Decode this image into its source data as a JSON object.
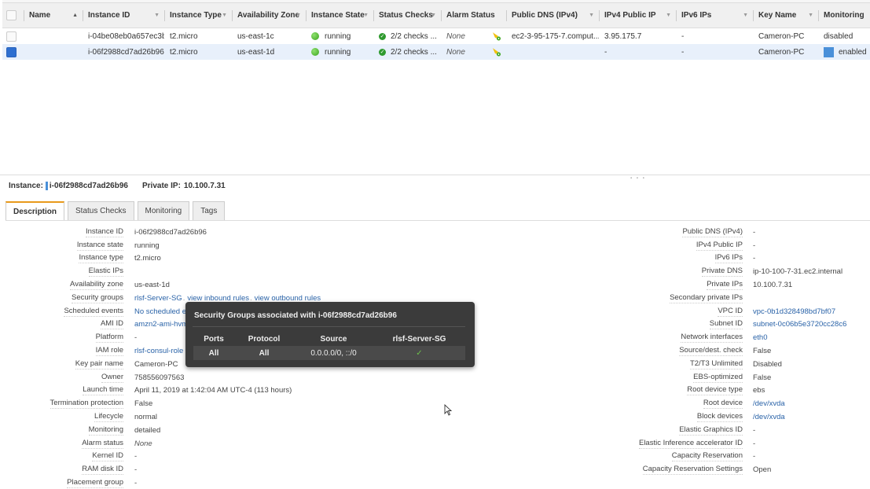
{
  "table": {
    "columns": [
      {
        "label": "Name",
        "sort": "asc"
      },
      {
        "label": "Instance ID"
      },
      {
        "label": "Instance Type"
      },
      {
        "label": "Availability Zone"
      },
      {
        "label": "Instance State"
      },
      {
        "label": "Status Checks"
      },
      {
        "label": "Alarm Status"
      },
      {
        "label": "Public DNS (IPv4)"
      },
      {
        "label": "IPv4 Public IP"
      },
      {
        "label": "IPv6 IPs"
      },
      {
        "label": "Key Name"
      },
      {
        "label": "Monitoring"
      }
    ],
    "rows": [
      {
        "selected": false,
        "name": "",
        "instance_id": "i-04be08eb0a657ec3b",
        "instance_type": "t2.micro",
        "availability_zone": "us-east-1c",
        "instance_state": "running",
        "status_checks": "2/2 checks ...",
        "alarm_status": "None",
        "public_dns": "ec2-3-95-175-7.comput...",
        "ipv4_public_ip": "3.95.175.7",
        "ipv6_ips": "-",
        "key_name": "Cameron-PC",
        "monitoring": "disabled"
      },
      {
        "selected": true,
        "name": "",
        "instance_id": "i-06f2988cd7ad26b96",
        "instance_type": "t2.micro",
        "availability_zone": "us-east-1d",
        "instance_state": "running",
        "status_checks": "2/2 checks ...",
        "alarm_status": "None",
        "public_dns": "",
        "ipv4_public_ip": "-",
        "ipv6_ips": "-",
        "key_name": "Cameron-PC",
        "monitoring": "enabled"
      }
    ]
  },
  "selection": {
    "instance_label": "Instance:",
    "instance_id": "i-06f2988cd7ad26b96",
    "private_ip_label": "Private IP:",
    "private_ip": "10.100.7.31"
  },
  "tabs": [
    {
      "label": "Description",
      "active": true
    },
    {
      "label": "Status Checks"
    },
    {
      "label": "Monitoring"
    },
    {
      "label": "Tags"
    }
  ],
  "description_left": [
    {
      "label": "Instance ID",
      "value": "i-06f2988cd7ad26b96"
    },
    {
      "label": "Instance state",
      "value": "running"
    },
    {
      "label": "Instance type",
      "value": "t2.micro"
    },
    {
      "label": "Elastic IPs",
      "value": ""
    },
    {
      "label": "Availability zone",
      "value": "us-east-1d"
    },
    {
      "label": "Security groups",
      "value": "rlsf-Server-SG",
      "link": true,
      "extra_links": [
        "view inbound rules",
        "view outbound rules"
      ]
    },
    {
      "label": "Scheduled events",
      "value": "No scheduled events",
      "link": true
    },
    {
      "label": "AMI ID",
      "value": "amzn2-ami-hvm",
      "link": true
    },
    {
      "label": "Platform",
      "value": "-"
    },
    {
      "label": "IAM role",
      "value": "rlsf-consul-role",
      "link": true
    },
    {
      "label": "Key pair name",
      "value": "Cameron-PC"
    },
    {
      "label": "Owner",
      "value": "758556097563"
    },
    {
      "label": "Launch time",
      "value": "April 11, 2019 at 1:42:04 AM UTC-4 (113 hours)"
    },
    {
      "label": "Termination protection",
      "value": "False"
    },
    {
      "label": "Lifecycle",
      "value": "normal"
    },
    {
      "label": "Monitoring",
      "value": "detailed"
    },
    {
      "label": "Alarm status",
      "value": "None",
      "italic": true
    },
    {
      "label": "Kernel ID",
      "value": "-"
    },
    {
      "label": "RAM disk ID",
      "value": "-"
    },
    {
      "label": "Placement group",
      "value": "-"
    }
  ],
  "description_right": [
    {
      "label": "Public DNS (IPv4)",
      "value": "-"
    },
    {
      "label": "IPv4 Public IP",
      "value": "-"
    },
    {
      "label": "IPv6 IPs",
      "value": "-"
    },
    {
      "label": "Private DNS",
      "value": "ip-10-100-7-31.ec2.internal"
    },
    {
      "label": "Private IPs",
      "value": "10.100.7.31"
    },
    {
      "label": "Secondary private IPs",
      "value": ""
    },
    {
      "label": "VPC ID",
      "value": "vpc-0b1d328498bd7bf07",
      "link": true
    },
    {
      "label": "Subnet ID",
      "value": "subnet-0c06b5e3720cc28c6",
      "link": true
    },
    {
      "label": "Network interfaces",
      "value": "eth0",
      "link": true
    },
    {
      "label": "Source/dest. check",
      "value": "False"
    },
    {
      "label": "T2/T3 Unlimited",
      "value": "Disabled"
    },
    {
      "label": "EBS-optimized",
      "value": "False"
    },
    {
      "label": "Root device type",
      "value": "ebs"
    },
    {
      "label": "Root device",
      "value": "/dev/xvda",
      "link": true
    },
    {
      "label": "Block devices",
      "value": "/dev/xvda",
      "link": true
    },
    {
      "label": "Elastic Graphics ID",
      "value": "-"
    },
    {
      "label": "Elastic Inference accelerator ID",
      "value": "-"
    },
    {
      "label": "Capacity Reservation",
      "value": "-"
    },
    {
      "label": "Capacity Reservation Settings",
      "value": "Open"
    }
  ],
  "popover": {
    "title": "Security Groups associated with i-06f2988cd7ad26b96",
    "headers": [
      "Ports",
      "Protocol",
      "Source",
      "rlsf-Server-SG"
    ],
    "rows": [
      {
        "ports": "All",
        "protocol": "All",
        "source": "0.0.0.0/0, ::/0",
        "allowed": "✓"
      }
    ]
  },
  "colors": {
    "accent_tab": "#e89a1c",
    "link": "#2a63a8",
    "selected_row": "#e8f0fb",
    "running": "#3aa51c",
    "popover_bg": "#3b3b3b"
  }
}
